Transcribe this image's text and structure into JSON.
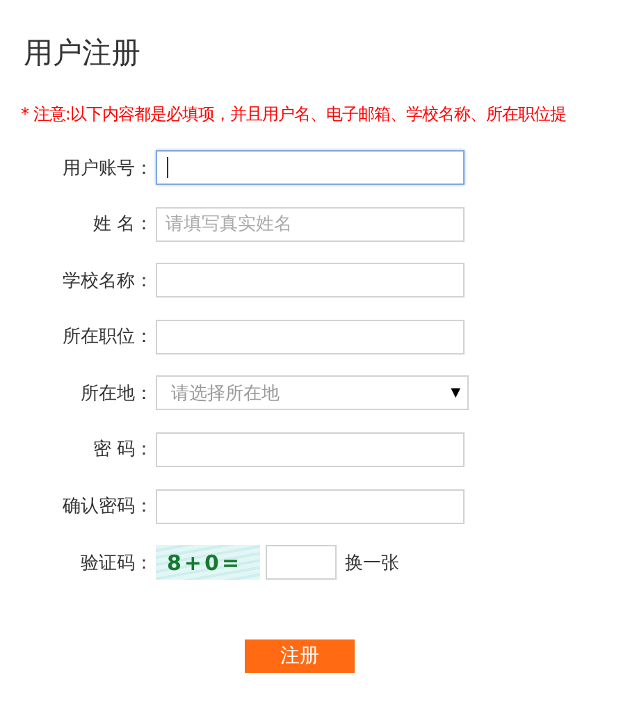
{
  "title": "用户注册",
  "notice": "* 注意:以下内容都是必填项，并且用户名、电子邮箱、学校名称、所在职位提",
  "fields": [
    {
      "kind": "text",
      "label": "用户账号：",
      "focused": true
    },
    {
      "kind": "text",
      "label": "姓 名：",
      "placeholder": "请填写真实姓名",
      "focused": false
    },
    {
      "kind": "text",
      "label": "学校名称：",
      "focused": false
    },
    {
      "kind": "text",
      "label": "所在职位：",
      "focused": false
    },
    {
      "kind": "select",
      "label": "所在地：",
      "placeholder": "请选择所在地",
      "arrow": "▼"
    },
    {
      "kind": "text",
      "label": "密 码：",
      "focused": false
    },
    {
      "kind": "text",
      "label": "确认密码：",
      "focused": false
    },
    {
      "kind": "captcha",
      "label": "验证码：",
      "captcha": "8+0=",
      "refresh": "换一张"
    }
  ],
  "submit": "注册"
}
